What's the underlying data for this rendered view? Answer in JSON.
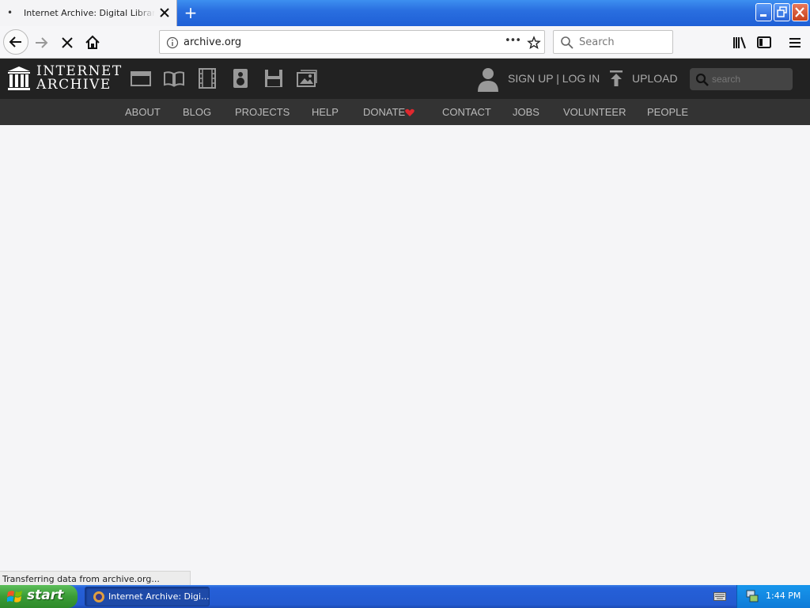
{
  "browser": {
    "tab_title": "Internet Archive: Digital Library of",
    "tab_dot": "•",
    "new_tab": "+",
    "url": "archive.org",
    "search_placeholder": "Search",
    "overflow": "•••"
  },
  "ia_header": {
    "logo_line1": "INTERNET",
    "logo_line2": "ARCHIVE",
    "signup_login": "SIGN UP | LOG IN",
    "upload": "UPLOAD",
    "search_placeholder": "search",
    "nav": [
      "ABOUT",
      "BLOG",
      "PROJECTS",
      "HELP",
      "DONATE",
      "CONTACT",
      "JOBS",
      "VOLUNTEER",
      "PEOPLE"
    ]
  },
  "status_text": "Transferring data from archive.org...",
  "taskbar": {
    "start": "start",
    "task_label": "Internet Archive: Digi...",
    "clock": "1:44 PM"
  },
  "colors": {
    "accent_heart": "#e0282e",
    "header_dark": "#222222",
    "nav_dark": "#333333"
  }
}
